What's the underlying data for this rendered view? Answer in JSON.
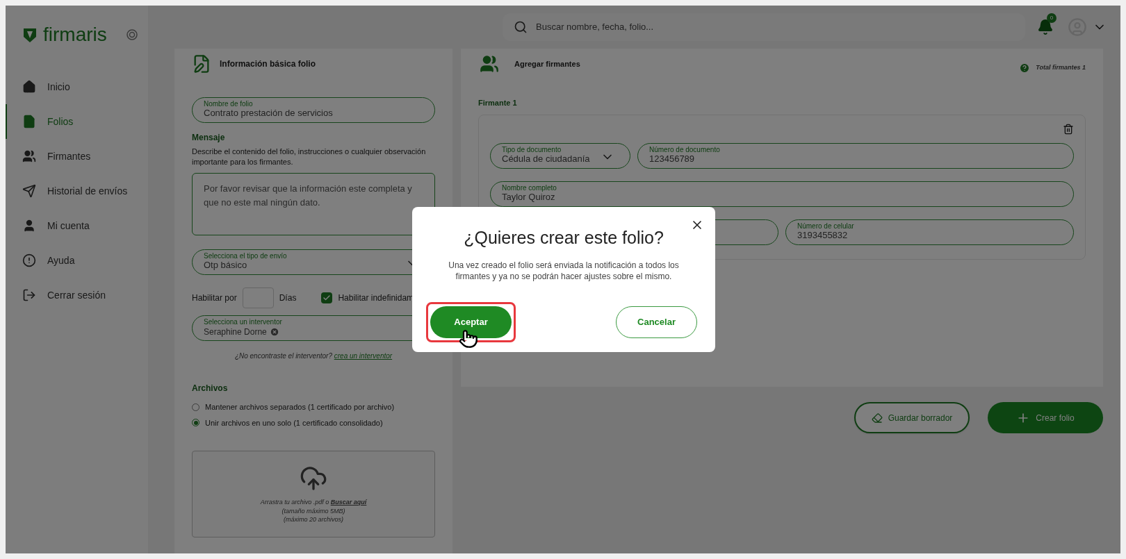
{
  "logo": {
    "text": "firmaris"
  },
  "sidebar": {
    "items": [
      {
        "label": "Inicio",
        "kind": "home",
        "selected": false
      },
      {
        "label": "Folios",
        "kind": "file",
        "selected": true
      },
      {
        "label": "Firmantes",
        "kind": "users",
        "selected": false
      },
      {
        "label": "Historial de envíos",
        "kind": "send",
        "selected": false
      },
      {
        "label": "Mi cuenta",
        "kind": "user",
        "selected": false
      },
      {
        "label": "Ayuda",
        "kind": "alert",
        "selected": false
      },
      {
        "label": "Cerrar sesión",
        "kind": "logout",
        "selected": false
      }
    ]
  },
  "search": {
    "placeholder": "Buscar nombre, fecha, folio..."
  },
  "notifications": {
    "count": "0"
  },
  "basic_info": {
    "title": "Información básica folio",
    "folio_name": {
      "label": "Nombre de folio",
      "value": "Contrato prestación de servicios"
    },
    "message": {
      "title": "Mensaje",
      "description": "Describe el contenido del folio, instrucciones o cualquier observación importante para los firmantes.",
      "value": "Por favor revisar que la información este completa y que no este mal ningún dato."
    },
    "send_type": {
      "label": "Selecciona el tipo de envío",
      "value": "Otp básico"
    },
    "enable_for": {
      "label": "Habilitar por",
      "unit": "Días"
    },
    "indefinite": {
      "label": "Habilitar indefinidam",
      "checked": true
    },
    "intervenor": {
      "label": "Selecciona un interventor",
      "chips": [
        "Seraphine Dorne"
      ]
    },
    "not_found": {
      "text": "¿No encontraste el interventor?",
      "link": "crea un interventor"
    },
    "files": {
      "title": "Archivos",
      "options": [
        {
          "label": "Mantener archivos separados (1 certificado por archivo)",
          "selected": false
        },
        {
          "label": "Unir archivos en uno solo (1 certificado consolidado)",
          "selected": true
        }
      ]
    },
    "upload": {
      "text": "Arrastra tu archivo .pdf o",
      "link": "Buscar aquí",
      "lines": [
        "(tamaño máximo 5MB)",
        "(máximo 20 archivos)"
      ]
    }
  },
  "signers": {
    "title": "Agregar firmantes",
    "total": "Total firmantes 1",
    "items": [
      {
        "title": "Firmante 1",
        "rows": [
          [
            {
              "kind": "select",
              "label": "Tipo de documento",
              "value": "Cédula de ciudadanía"
            },
            {
              "kind": "text",
              "label": "Número de documento",
              "value": "123456789"
            }
          ],
          [
            {
              "kind": "text",
              "label": "Nombre completo",
              "value": "Taylor Quiroz"
            }
          ],
          [
            {
              "kind": "text"
            },
            {
              "kind": "text",
              "label": "Número de celular",
              "value": "3193455832"
            }
          ]
        ]
      }
    ]
  },
  "actions": [
    {
      "kind": "outline",
      "label": "Guardar borrador"
    },
    {
      "kind": "solid",
      "label": "Crear folio"
    }
  ],
  "dialog": {
    "title": "¿Quieres crear este folio?",
    "message": "Una vez creado el folio será enviada la notificación a todos los firmantes y ya no se podrán hacer ajustes sobre el mismo.",
    "buttons": [
      {
        "kind": "primary",
        "label": "Aceptar",
        "highlighted": true
      },
      {
        "kind": "secondary",
        "label": "Cancelar",
        "highlighted": false
      }
    ]
  }
}
